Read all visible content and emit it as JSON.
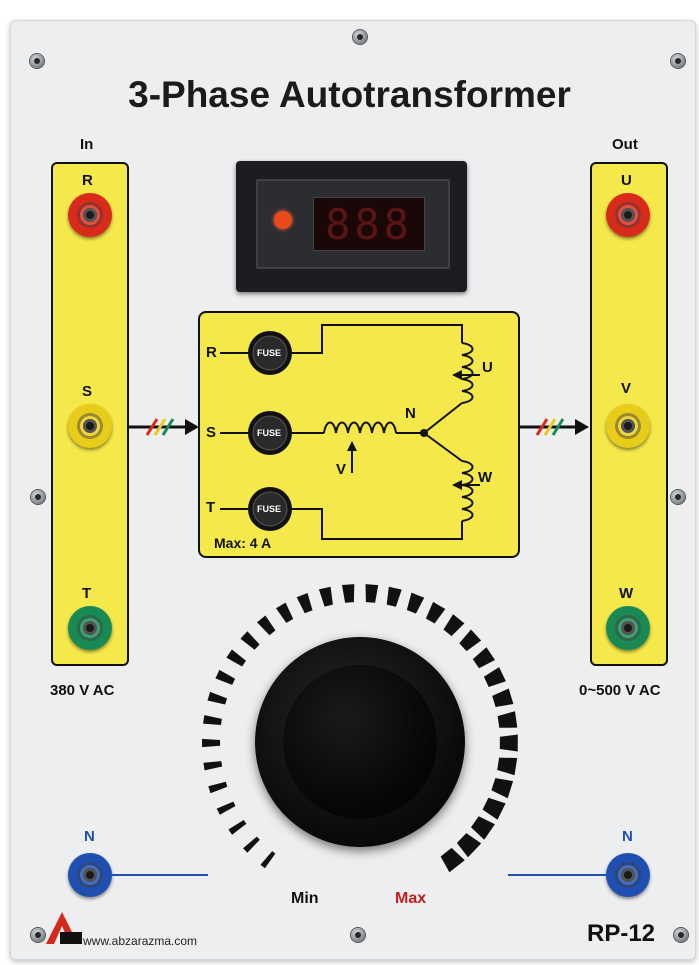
{
  "title": "3-Phase Autotransformer",
  "input": {
    "header": "In",
    "voltage": "380 V AC",
    "jacks": [
      {
        "label": "R",
        "color": "#d92b1c"
      },
      {
        "label": "S",
        "color": "#e8cc1a"
      },
      {
        "label": "T",
        "color": "#1a8a55"
      }
    ]
  },
  "output": {
    "header": "Out",
    "voltage": "0~500 V AC",
    "jacks": [
      {
        "label": "U",
        "color": "#d92b1c"
      },
      {
        "label": "V",
        "color": "#e8cc1a"
      },
      {
        "label": "W",
        "color": "#1a8a55"
      }
    ]
  },
  "meter": {
    "digits": "888"
  },
  "schematic": {
    "fuse_label": "FUSE",
    "inputs": [
      "R",
      "S",
      "T"
    ],
    "outputs": [
      "U",
      "V",
      "W"
    ],
    "neutral": "N",
    "wiper": "V",
    "max_current": "Max: 4 A"
  },
  "dial": {
    "min_label": "Min",
    "max_label": "Max",
    "max_color": "#c41e1e"
  },
  "neutral_jacks": {
    "label": "N",
    "color": "#1f4fb0"
  },
  "footer": {
    "url": "www.abzarazma.com",
    "model": "RP-12"
  }
}
